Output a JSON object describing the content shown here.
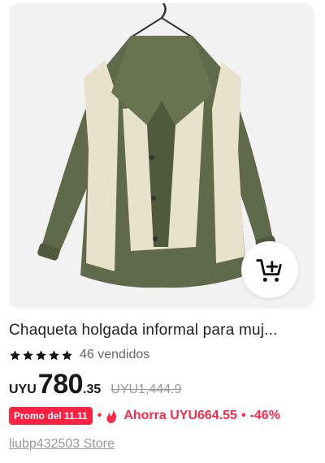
{
  "product": {
    "title": "Chaqueta holgada informal para muj...",
    "image_alt": "olive green and cream layered jacket on hanger",
    "rating_stars": 5,
    "sold_text": "46 vendidos",
    "currency": "UYU",
    "price_integer": "780",
    "price_decimal": ".35",
    "original_price": "UYU1,444.9",
    "promo_badge": "Promo del 11.11",
    "bullet": "•",
    "savings_text": "Ahorra UYU664.55",
    "discount_text": "-46%",
    "store_name": "liubp432503 Store"
  },
  "icons": {
    "cart": "add-to-cart-icon",
    "star": "star-icon",
    "flame": "flame-icon"
  },
  "colors": {
    "accent_red": "#fe2142",
    "jacket_green": "#5f6a4a",
    "jacket_cream": "#e8e1cc"
  }
}
